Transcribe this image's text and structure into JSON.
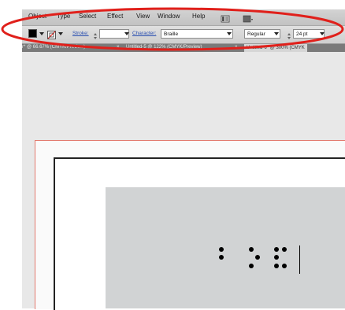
{
  "menu": {
    "items": [
      "Object",
      "Type",
      "Select",
      "Effect",
      "View",
      "Window",
      "Help"
    ]
  },
  "control_bar": {
    "stroke_label": "Stroke:",
    "character_label": "Character:",
    "font_family": "Braille",
    "font_style": "Regular",
    "font_size": "24 pt"
  },
  "tabs": [
    {
      "label": "r* @ 66.67% (CMYK/Preview)",
      "active": false
    },
    {
      "label": "Untitled-5 @ 122% (CMYK/Preview)",
      "active": false
    },
    {
      "label": "Untitled-6* @ 300% (CMYK",
      "active": true
    }
  ],
  "braille_text": "Braille cells",
  "colors": {
    "annotation": "#e0201b",
    "bleed_guide": "#e27a6e",
    "frame_fill": "#d1d3d4"
  },
  "icons": [
    "fill-color-icon",
    "stroke-none-icon",
    "graphic-style-icon",
    "stroke-weight-icon"
  ]
}
